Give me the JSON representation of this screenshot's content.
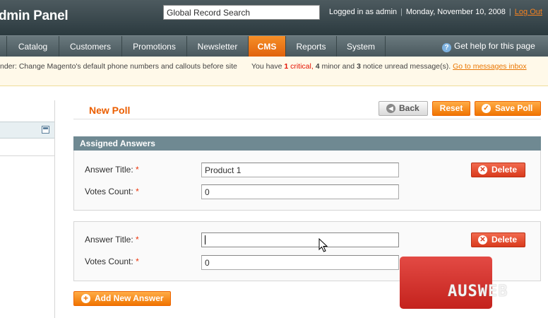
{
  "header": {
    "app_title": "dmin Panel",
    "search_value": "Global Record Search",
    "logged_in": "Logged in as admin",
    "date": "Monday, November 10, 2008",
    "logout": "Log Out"
  },
  "nav": {
    "items": [
      "Catalog",
      "Customers",
      "Promotions",
      "Newsletter",
      "CMS",
      "Reports",
      "System"
    ],
    "active": "CMS",
    "help": "Get help for this page"
  },
  "notice": {
    "left_text": "nder: Change Magento's default phone numbers and callouts before site",
    "right_prefix": "You have",
    "critical_count": "1",
    "critical_label": "critical,",
    "minor_count": "4",
    "minor_label": "minor and",
    "notice_count": "3",
    "notice_label": "notice unread message(s).",
    "link": "Go to messages inbox"
  },
  "page": {
    "title": "New Poll",
    "back_label": "Back",
    "reset_label": "Reset",
    "save_label": "Save Poll",
    "section_title": "Assigned Answers",
    "add_answer_label": "Add New Answer"
  },
  "answers": [
    {
      "title_label": "Answer Title:",
      "votes_label": "Votes Count:",
      "title_value": "Product 1",
      "votes_value": "0",
      "delete_label": "Delete"
    },
    {
      "title_label": "Answer Title:",
      "votes_label": "Votes Count:",
      "title_value": "",
      "votes_value": "0",
      "delete_label": "Delete"
    }
  ],
  "required_mark": "*",
  "watermark": "AUSWEB",
  "icons": {
    "help": "help-circle-icon",
    "back": "back-arrow-icon",
    "save": "checkmark-icon",
    "delete": "delete-x-icon",
    "add": "plus-icon",
    "left_save": "floppy-disk-icon",
    "cursor": "mouse-pointer-icon"
  }
}
